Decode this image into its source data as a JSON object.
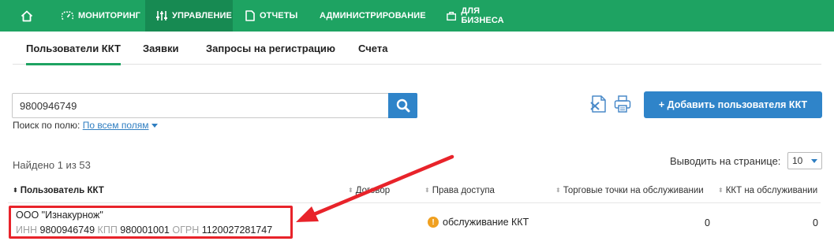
{
  "nav": {
    "items": [
      {
        "label": "МОНИТОРИНГ"
      },
      {
        "label": "УПРАВЛЕНИЕ"
      },
      {
        "label": "ОТЧЕТЫ"
      },
      {
        "label": "АДМИНИСТРИРОВАНИЕ"
      },
      {
        "label": "ДЛЯ БИЗНЕСА"
      }
    ],
    "icons": [
      "home-icon",
      "monitoring-icon",
      "sliders-icon",
      "document-icon",
      "gear-icon",
      "briefcase-icon"
    ],
    "active": "УПРАВЛЕНИЕ"
  },
  "tabs": [
    {
      "label": "Пользователи ККТ"
    },
    {
      "label": "Заявки"
    },
    {
      "label": "Запросы на регистрацию"
    },
    {
      "label": "Счета"
    }
  ],
  "search": {
    "value": "9800946749",
    "field_label": "Поиск по полю:",
    "field_value": "По всем полям"
  },
  "toolbar": {
    "add_button": "+ Добавить пользователя ККТ",
    "icons": [
      "excel-export-icon",
      "print-icon"
    ]
  },
  "results": {
    "found_text": "Найдено 1 из 53",
    "per_page_label": "Выводить на странице:",
    "per_page_value": "10"
  },
  "table": {
    "columns": [
      {
        "label": "Пользователь ККТ"
      },
      {
        "label": "Договор"
      },
      {
        "label": "Права доступа"
      },
      {
        "label": "Торговые точки на обслуживании"
      },
      {
        "label": "ККТ на обслуживании"
      }
    ],
    "rows": [
      {
        "name": "ООО \"Изнакурнож\"",
        "inn_label": "ИНН",
        "inn": "9800946749",
        "kpp_label": "КПП",
        "kpp": "980001001",
        "ogrn_label": "ОГРН",
        "ogrn": "1120027281747",
        "contract": "",
        "access": "обслуживание ККТ",
        "points": "0",
        "kkt": "0"
      }
    ]
  },
  "colors": {
    "nav_bg": "#1ea362",
    "nav_active": "#178a52",
    "primary": "#2f84c9",
    "annotation": "#e8232a",
    "warning": "#f0a020"
  }
}
